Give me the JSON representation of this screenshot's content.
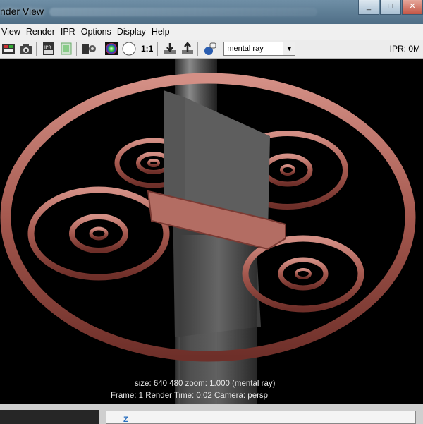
{
  "window": {
    "title": "nder View",
    "buttons": [
      "_",
      "□",
      "✕"
    ]
  },
  "menubar": {
    "items": [
      "View",
      "Render",
      "IPR",
      "Options",
      "Display",
      "Help"
    ]
  },
  "toolbar": {
    "ratio_label": "1:1",
    "renderer": "mental ray",
    "ipr_status": "IPR: 0M",
    "icons": [
      "redo-render-icon",
      "snapshot-icon",
      "ipr-render-icon",
      "refresh-region-icon",
      "render-settings-icon",
      "color-channel-icon",
      "alpha-channel-icon",
      "keep-image-icon",
      "remove-image-icon",
      "render-globals-icon"
    ]
  },
  "status": {
    "line1": "size:  640  480 zoom: 1.000       (mental ray)",
    "line2": "Frame: 1      Render Time: 0:02       Camera: persp"
  },
  "bottom": {
    "axis": "Z"
  }
}
